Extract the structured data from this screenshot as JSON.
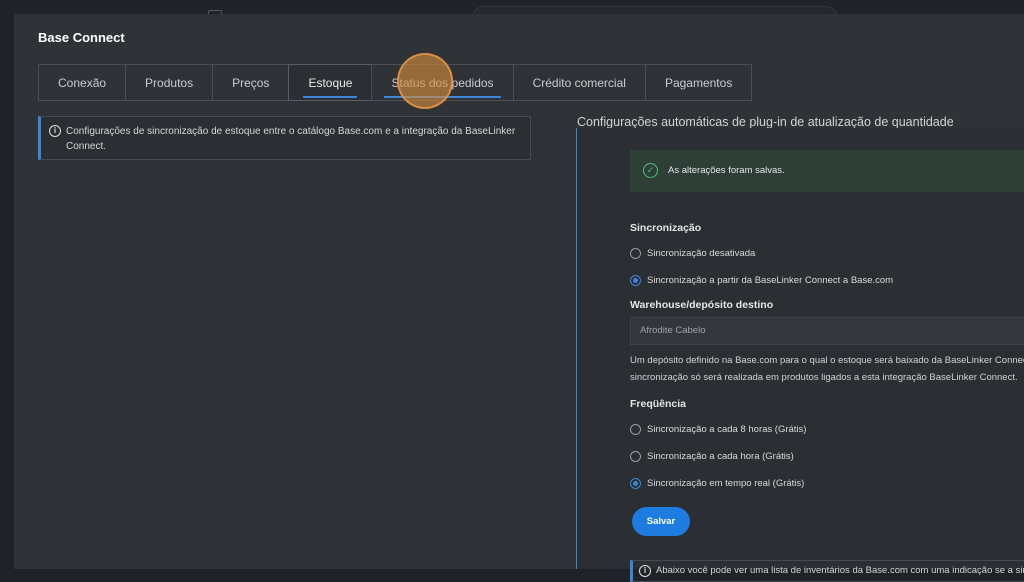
{
  "modal": {
    "title": "Base Connect"
  },
  "tabs": [
    {
      "label": "Conexão"
    },
    {
      "label": "Produtos"
    },
    {
      "label": "Preços"
    },
    {
      "label": "Estoque"
    },
    {
      "label": "Status dos pedidos"
    },
    {
      "label": "Crédito comercial"
    },
    {
      "label": "Pagamentos"
    }
  ],
  "info_left": {
    "text": "Configurações de sincronização de estoque entre o catálogo Base.com e a integração da BaseLinker Connect."
  },
  "section": {
    "title": "Configurações automáticas de plug-in de atualização de quantidade"
  },
  "success": {
    "message": "As alterações foram salvas."
  },
  "sync": {
    "label": "Sincronização",
    "options": [
      {
        "label": "Sincronização desativada",
        "checked": false
      },
      {
        "label": "Sincronização a partir da BaseLinker Connect a Base.com",
        "checked": true
      }
    ]
  },
  "warehouse": {
    "label": "Warehouse/depósito destino",
    "value": "Afrodite Cabelo",
    "help_line1": "Um depósito definido na Base.com para o qual o estoque será baixado da BaseLinker Connect",
    "help_line2": "sincronização só será realizada em produtos ligados a esta integração BaseLinker Connect."
  },
  "frequency": {
    "label": "Freqüência",
    "options": [
      {
        "label": "Sincronização a cada 8 horas (Grátis)",
        "checked": false
      },
      {
        "label": "Sincronização a cada hora (Grátis)",
        "checked": false
      },
      {
        "label": "Sincronização em tempo real (Grátis)",
        "checked": true
      }
    ]
  },
  "save_label": "Salvar",
  "info_bottom": {
    "text": "Abaixo você pode ver uma lista de inventários da Base.com com uma indicação se a sinc"
  },
  "colors": {
    "accent": "#1e7be0",
    "success": "#4fc37a",
    "modal_bg": "#2f3237"
  }
}
